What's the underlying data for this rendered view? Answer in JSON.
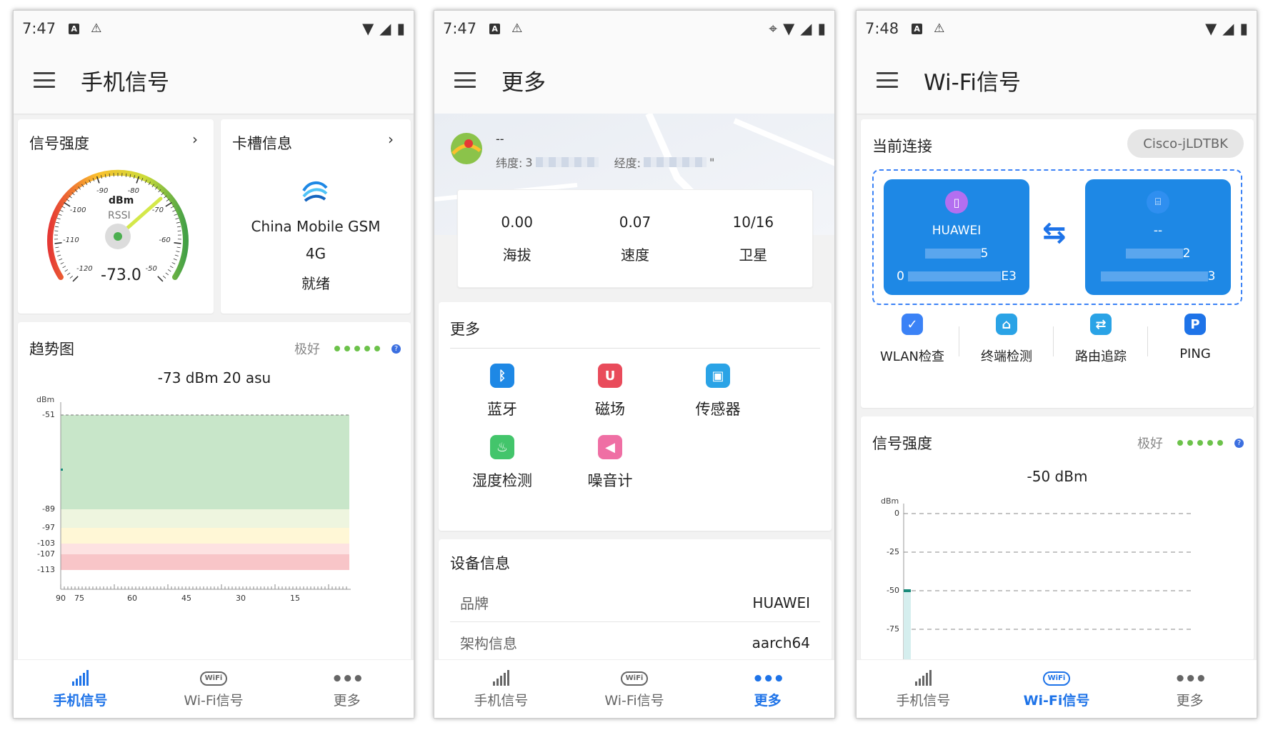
{
  "screens": [
    {
      "status": {
        "time": "7:47"
      },
      "appbar": {
        "title": "手机信号"
      },
      "signal_card": {
        "title": "信号强度",
        "unit": "dBm",
        "label": "RSSI",
        "value": "-73.0",
        "ticks": [
          "-120",
          "-110",
          "-100",
          "-90",
          "-80",
          "-70",
          "-60",
          "-50"
        ]
      },
      "sim_card": {
        "title": "卡槽信息",
        "operator": "China Mobile GSM",
        "network": "4G",
        "state": "就绪"
      },
      "trend_card": {
        "title": "趋势图",
        "rating": "极好",
        "reading": "-73 dBm  20 asu",
        "y_unit": "dBm",
        "y_ticks": [
          "-51",
          "-89",
          "-97",
          "-103",
          "-107",
          "-113"
        ],
        "x_ticks": [
          "90",
          "75",
          "60",
          "45",
          "30",
          "15"
        ]
      }
    },
    {
      "status": {
        "time": "7:47"
      },
      "appbar": {
        "title": "更多"
      },
      "location": {
        "name": "--",
        "lat_label": "纬度:",
        "lat_value": "3",
        "lon_label": "经度:",
        "lon_value": "\""
      },
      "stats": [
        {
          "value": "0.00",
          "label": "海拔"
        },
        {
          "value": "0.07",
          "label": "速度"
        },
        {
          "value": "10/16",
          "label": "卫星"
        }
      ],
      "more_card": {
        "title": "更多",
        "tools": [
          {
            "label": "蓝牙",
            "icon": "bluetooth-icon",
            "color": "#1e88e5"
          },
          {
            "label": "磁场",
            "icon": "magnet-icon",
            "color": "#e94b5b"
          },
          {
            "label": "传感器",
            "icon": "sensor-icon",
            "color": "#2aa3e6"
          },
          {
            "label": "湿度检测",
            "icon": "humidity-icon",
            "color": "#43c56b"
          },
          {
            "label": "噪音计",
            "icon": "noise-meter-icon",
            "color": "#ef6fa4"
          }
        ]
      },
      "device_card": {
        "title": "设备信息",
        "rows": [
          {
            "key": "品牌",
            "value": "HUAWEI"
          },
          {
            "key": "架构信息",
            "value": "aarch64"
          }
        ]
      }
    },
    {
      "status": {
        "time": "7:48"
      },
      "appbar": {
        "title": "Wi-Fi信号"
      },
      "connection_card": {
        "title": "当前连接",
        "ssid": "Cisco-jLDTBK",
        "device_name": "HUAWEI",
        "device_line1_end": "5",
        "device_line2_start": "0",
        "device_line2_end": "E3",
        "router_name": "--",
        "router_line1_end": "2",
        "router_line2_end": "3",
        "tools": [
          {
            "label": "WLAN检查",
            "icon": "wlan-check-icon"
          },
          {
            "label": "终端检测",
            "icon": "terminal-detect-icon"
          },
          {
            "label": "路由追踪",
            "icon": "route-trace-icon"
          },
          {
            "label": "PING",
            "icon": "ping-icon"
          }
        ]
      },
      "strength_card": {
        "title": "信号强度",
        "rating": "极好",
        "reading": "-50  dBm",
        "y_unit": "dBm",
        "y_ticks": [
          "0",
          "-25",
          "-50",
          "-75"
        ]
      }
    }
  ],
  "nav": {
    "cellular": "手机信号",
    "wifi": "Wi-Fi信号",
    "more": "更多",
    "wifi_badge": "WiFi"
  },
  "colors": {
    "accent": "#1e73e8",
    "good": "#6cc24a"
  }
}
